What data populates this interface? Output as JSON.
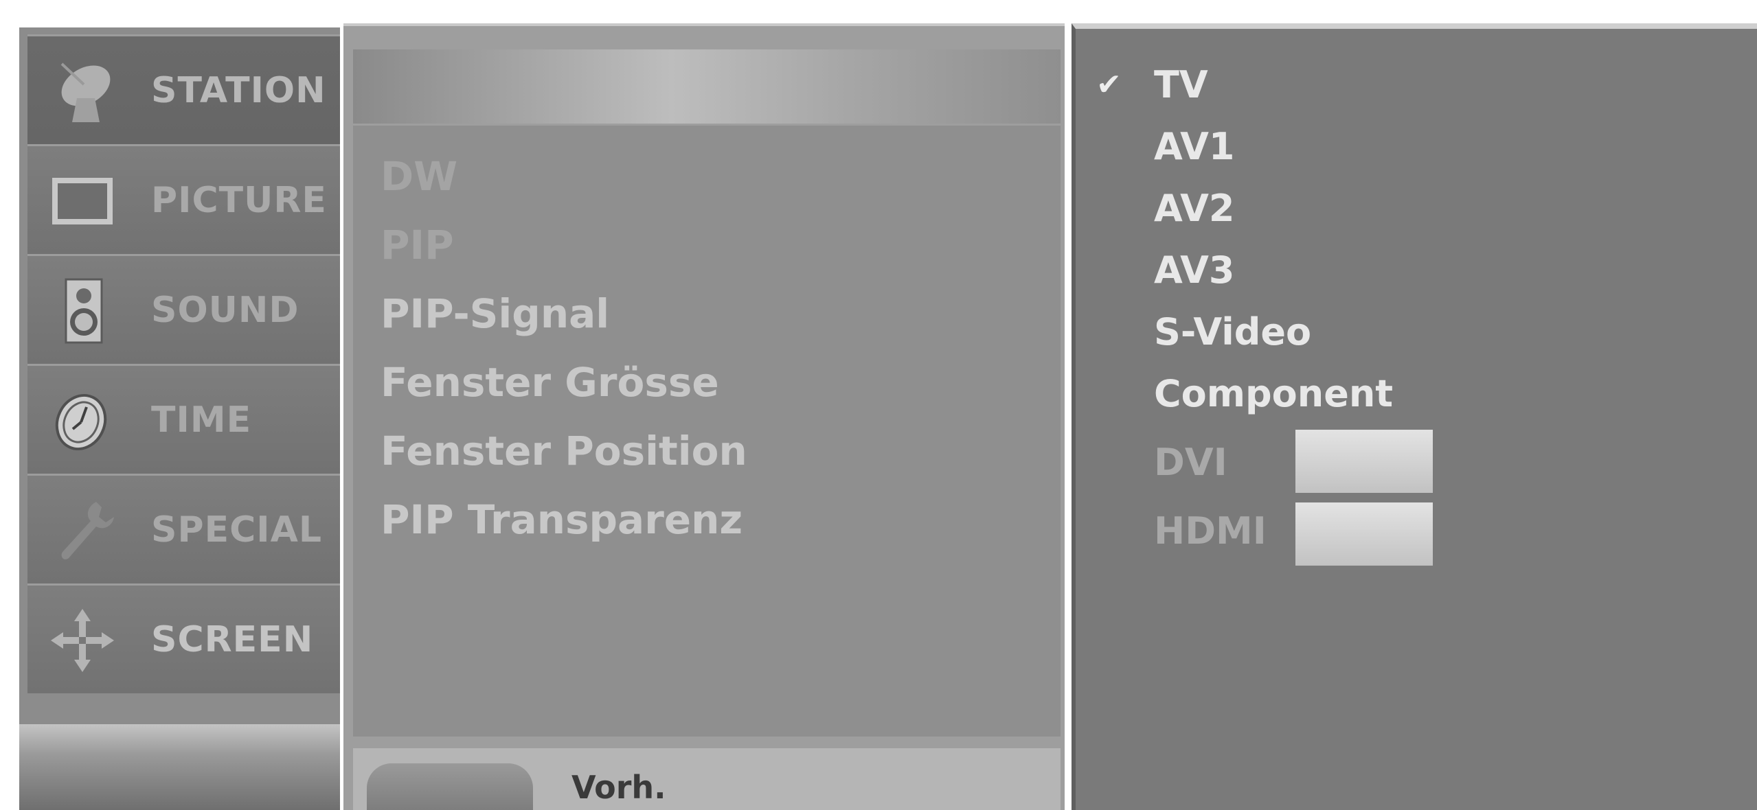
{
  "sidebar": {
    "items": [
      {
        "label": "STATION",
        "icon": "satellite-dish-icon"
      },
      {
        "label": "PICTURE",
        "icon": "monitor-icon"
      },
      {
        "label": "SOUND",
        "icon": "speaker-icon"
      },
      {
        "label": "TIME",
        "icon": "clock-icon"
      },
      {
        "label": "SPECIAL",
        "icon": "wrench-icon"
      },
      {
        "label": "SCREEN",
        "icon": "move-arrows-icon"
      }
    ]
  },
  "menu": {
    "items": [
      "DW",
      "PIP",
      "PIP-Signal",
      "Fenster Grösse",
      "Fenster Position",
      "PIP Transparenz"
    ]
  },
  "footer": {
    "back_label": "Vorh."
  },
  "signal": {
    "selected_mark": "✔",
    "options": [
      "TV",
      "AV1",
      "AV2",
      "AV3",
      "S-Video",
      "Component",
      "DVI",
      "HDMI"
    ]
  },
  "colors": {
    "panel_dark": "#7a7a7a",
    "panel_mid": "#8f8f8f",
    "text_bright": "#e8e8e8",
    "text_dim": "#a9a9a9"
  }
}
